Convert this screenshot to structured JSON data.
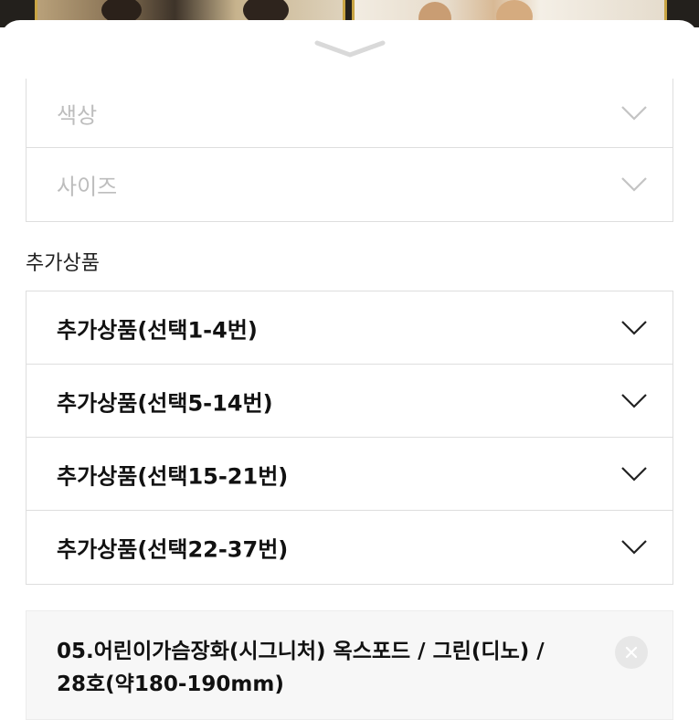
{
  "options": {
    "placeholders": [
      {
        "label": "색상"
      },
      {
        "label": "사이즈"
      }
    ]
  },
  "extra_section": {
    "title": "추가상품",
    "items": [
      {
        "label": "추가상품(선택1-4번)"
      },
      {
        "label": "추가상품(선택5-14번)"
      },
      {
        "label": "추가상품(선택15-21번)"
      },
      {
        "label": "추가상품(선택22-37번)"
      }
    ]
  },
  "selected_item": {
    "line1": "05.어린이가슴장화(시그니처) 옥스포드 / 그린(디노) /",
    "line2": "28호(약180-190mm)"
  },
  "icons": {
    "dropdown": "chevron-down-icon",
    "remove": "close-icon",
    "handle": "sheet-handle-icon"
  },
  "colors": {
    "placeholder_text": "#bdbdbd",
    "border": "#dedede",
    "card_bg": "#f7f7f7"
  }
}
